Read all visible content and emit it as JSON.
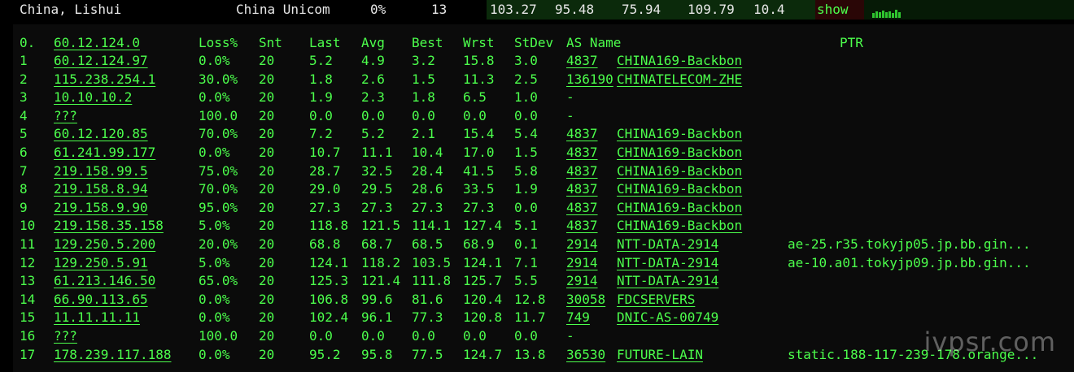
{
  "topbar": {
    "location": "China, Lishui",
    "isp": "China Unicom",
    "loss": "0%",
    "sent": "13",
    "last": "103.27",
    "avg": "95.48",
    "best": "75.94",
    "worst": "109.79",
    "stdev": "10.4",
    "show_label": "show"
  },
  "headers": {
    "hop": "0.",
    "host": "60.12.124.0",
    "loss": "Loss%",
    "snt": "Snt",
    "last": "Last",
    "avg": "Avg",
    "best": "Best",
    "wrst": "Wrst",
    "stdev": "StDev",
    "asname": "AS Name",
    "ptr": "PTR"
  },
  "rows": [
    {
      "hop": "1",
      "host": "60.12.124.97",
      "loss": "0.0%",
      "snt": "20",
      "last": "5.2",
      "avg": "4.9",
      "best": "3.2",
      "wrst": "15.8",
      "stdev": "3.0",
      "asn": "4837",
      "asname": "CHINA169-Backbon",
      "ptr": ""
    },
    {
      "hop": "2",
      "host": "115.238.254.1",
      "loss": "30.0%",
      "snt": "20",
      "last": "1.8",
      "avg": "2.6",
      "best": "1.5",
      "wrst": "11.3",
      "stdev": "2.5",
      "asn": "136190",
      "asname": "CHINATELECOM-ZHE",
      "ptr": ""
    },
    {
      "hop": "3",
      "host": "10.10.10.2",
      "loss": "0.0%",
      "snt": "20",
      "last": "1.9",
      "avg": "2.3",
      "best": "1.8",
      "wrst": "6.5",
      "stdev": "1.0",
      "asn": "-",
      "asname": "",
      "ptr": ""
    },
    {
      "hop": "4",
      "host": "???",
      "loss": "100.0",
      "snt": "20",
      "last": "0.0",
      "avg": "0.0",
      "best": "0.0",
      "wrst": "0.0",
      "stdev": "0.0",
      "asn": "-",
      "asname": "",
      "ptr": ""
    },
    {
      "hop": "5",
      "host": "60.12.120.85",
      "loss": "70.0%",
      "snt": "20",
      "last": "7.2",
      "avg": "5.2",
      "best": "2.1",
      "wrst": "15.4",
      "stdev": "5.4",
      "asn": "4837",
      "asname": "CHINA169-Backbon",
      "ptr": ""
    },
    {
      "hop": "6",
      "host": "61.241.99.177",
      "loss": "0.0%",
      "snt": "20",
      "last": "10.7",
      "avg": "11.1",
      "best": "10.4",
      "wrst": "17.0",
      "stdev": "1.5",
      "asn": "4837",
      "asname": "CHINA169-Backbon",
      "ptr": ""
    },
    {
      "hop": "7",
      "host": "219.158.99.5",
      "loss": "75.0%",
      "snt": "20",
      "last": "28.7",
      "avg": "32.5",
      "best": "28.4",
      "wrst": "41.5",
      "stdev": "5.8",
      "asn": "4837",
      "asname": "CHINA169-Backbon",
      "ptr": ""
    },
    {
      "hop": "8",
      "host": "219.158.8.94",
      "loss": "70.0%",
      "snt": "20",
      "last": "29.0",
      "avg": "29.5",
      "best": "28.6",
      "wrst": "33.5",
      "stdev": "1.9",
      "asn": "4837",
      "asname": "CHINA169-Backbon",
      "ptr": ""
    },
    {
      "hop": "9",
      "host": "219.158.9.90",
      "loss": "95.0%",
      "snt": "20",
      "last": "27.3",
      "avg": "27.3",
      "best": "27.3",
      "wrst": "27.3",
      "stdev": "0.0",
      "asn": "4837",
      "asname": "CHINA169-Backbon",
      "ptr": ""
    },
    {
      "hop": "10",
      "host": "219.158.35.158",
      "loss": "5.0%",
      "snt": "20",
      "last": "118.8",
      "avg": "121.5",
      "best": "114.1",
      "wrst": "127.4",
      "stdev": "5.1",
      "asn": "4837",
      "asname": "CHINA169-Backbon",
      "ptr": ""
    },
    {
      "hop": "11",
      "host": "129.250.5.200",
      "loss": "20.0%",
      "snt": "20",
      "last": "68.8",
      "avg": "68.7",
      "best": "68.5",
      "wrst": "68.9",
      "stdev": "0.1",
      "asn": "2914",
      "asname": "NTT-DATA-2914",
      "ptr": "ae-25.r35.tokyjp05.jp.bb.gin..."
    },
    {
      "hop": "12",
      "host": "129.250.5.91",
      "loss": "5.0%",
      "snt": "20",
      "last": "124.1",
      "avg": "118.2",
      "best": "103.5",
      "wrst": "124.1",
      "stdev": "7.1",
      "asn": "2914",
      "asname": "NTT-DATA-2914",
      "ptr": "ae-10.a01.tokyjp09.jp.bb.gin..."
    },
    {
      "hop": "13",
      "host": "61.213.146.50",
      "loss": "65.0%",
      "snt": "20",
      "last": "125.3",
      "avg": "121.4",
      "best": "111.8",
      "wrst": "125.7",
      "stdev": "5.5",
      "asn": "2914",
      "asname": "NTT-DATA-2914",
      "ptr": ""
    },
    {
      "hop": "14",
      "host": "66.90.113.65",
      "loss": "0.0%",
      "snt": "20",
      "last": "106.8",
      "avg": "99.6",
      "best": "81.6",
      "wrst": "120.4",
      "stdev": "12.8",
      "asn": "30058",
      "asname": "FDCSERVERS",
      "ptr": ""
    },
    {
      "hop": "15",
      "host": "11.11.11.11",
      "loss": "0.0%",
      "snt": "20",
      "last": "102.4",
      "avg": "96.1",
      "best": "77.3",
      "wrst": "120.8",
      "stdev": "11.7",
      "asn": "749",
      "asname": "DNIC-AS-00749",
      "ptr": ""
    },
    {
      "hop": "16",
      "host": "???",
      "loss": "100.0",
      "snt": "20",
      "last": "0.0",
      "avg": "0.0",
      "best": "0.0",
      "wrst": "0.0",
      "stdev": "0.0",
      "asn": "-",
      "asname": "",
      "ptr": ""
    },
    {
      "hop": "17",
      "host": "178.239.117.188",
      "loss": "0.0%",
      "snt": "20",
      "last": "95.2",
      "avg": "95.8",
      "best": "77.5",
      "wrst": "124.7",
      "stdev": "13.8",
      "asn": "36530",
      "asname": "FUTURE-LAIN",
      "ptr": "static.188-117-239-178.orange..."
    }
  ],
  "watermark": "ivpsr.com",
  "colors": {
    "text": "#4cff4c",
    "background": "#000000",
    "header_text": "#e8e8e8"
  }
}
